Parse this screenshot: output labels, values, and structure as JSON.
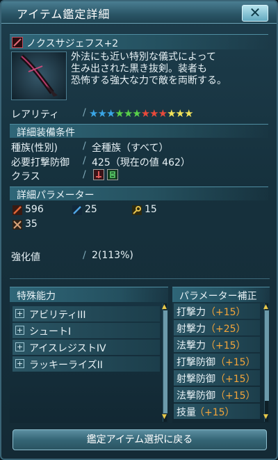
{
  "window": {
    "title": "アイテム鑑定詳細",
    "close_label": "✕"
  },
  "item": {
    "name": "ノクスサジェフス+2",
    "description": [
      "外法にも近い特別な儀式によって",
      "生み出された黒き抜剣。装者も",
      "恐怖する強大な力で敵を両断する。"
    ]
  },
  "rarity": {
    "label": "レアリティ",
    "separator": "/",
    "stars": [
      {
        "glyph": "★",
        "color": "#3aa6e6"
      },
      {
        "glyph": "★",
        "color": "#3aa6e6"
      },
      {
        "glyph": "★",
        "color": "#3aa6e6"
      },
      {
        "glyph": "★",
        "color": "#59d04a"
      },
      {
        "glyph": "★",
        "color": "#59d04a"
      },
      {
        "glyph": "★",
        "color": "#59d04a"
      },
      {
        "glyph": "★",
        "color": "#e84a3a"
      },
      {
        "glyph": "★",
        "color": "#e84a3a"
      },
      {
        "glyph": "★",
        "color": "#e84a3a"
      },
      {
        "glyph": "★",
        "color": "#f2e35a"
      },
      {
        "glyph": "★",
        "color": "#f2e35a"
      },
      {
        "glyph": "★",
        "color": "#f2e35a"
      }
    ]
  },
  "requirements": {
    "header": "詳細装備条件",
    "race_label": "種族(性別)",
    "race_value": "全種族（すべて）",
    "def_label": "必要打撃防御",
    "def_value": "425（現在の値 462）",
    "class_label": "クラス",
    "class_icons": [
      "hunter-icon",
      "fighter-icon"
    ]
  },
  "params": {
    "header": "詳細パラメーター",
    "stats": [
      {
        "icon": "striking-attack-icon",
        "value": "596",
        "color": "#e0663a"
      },
      {
        "icon": "ranged-attack-icon",
        "value": "25",
        "color": "#4fa7e6"
      },
      {
        "icon": "technique-attack-icon",
        "value": "15",
        "color": "#e6c34f"
      },
      {
        "icon": "dexterity-icon",
        "value": "35",
        "color": "#d8a37a"
      }
    ]
  },
  "grind": {
    "label": "強化値",
    "value": "2(113%)"
  },
  "abilities": {
    "header": "特殊能力",
    "items": [
      "アビリティIII",
      "シュートI",
      "アイスレジストIV",
      "ラッキーライズII"
    ]
  },
  "bonuses": {
    "header": "パラメーター補正",
    "items": [
      {
        "label": "打撃力",
        "value": "（+15）"
      },
      {
        "label": "射撃力",
        "value": "（+25）"
      },
      {
        "label": "法撃力",
        "value": "（+15）"
      },
      {
        "label": "打撃防御",
        "value": "（+15）"
      },
      {
        "label": "射撃防御",
        "value": "（+15）"
      },
      {
        "label": "法撃防御",
        "value": "（+15）"
      },
      {
        "label": "技量",
        "value": "（+15）"
      }
    ]
  },
  "footer": {
    "button_label": "鑑定アイテム選択に戻る"
  }
}
